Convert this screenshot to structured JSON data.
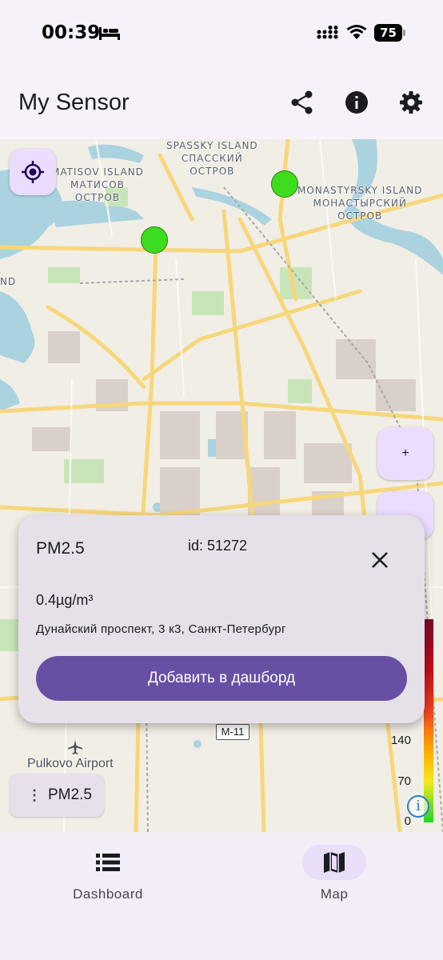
{
  "status_bar": {
    "time": "00:39",
    "battery": "75"
  },
  "app_bar": {
    "title": "My Sensor"
  },
  "map": {
    "labels": {
      "spassky": "SPASSKY ISLAND\nСПАССКИЙ\nОСТРОВ",
      "matisov": "MATISOV ISLAND\nМАТИСОВ\nОСТРОВ",
      "monastyrsky": "MONASTYRSKY ISLAND\nМОНАСТЫРСКИЙ\nОСТРОВ",
      "island_fragment": "ND",
      "pulkovo": "Pulkovo Airport",
      "m11": "M-11"
    },
    "zoom_in_label": "+",
    "sensor_color": "#3ddc1e",
    "legend": {
      "ticks": [
        "140",
        "70",
        "0"
      ],
      "info_glyph": "i"
    },
    "metric_chip": {
      "dots": "⋮",
      "label": "PM2.5"
    }
  },
  "popup": {
    "metric": "PM2.5",
    "id": "id: 51272",
    "value": "0.4µg/m³",
    "address": "Дунайский проспект, 3 к3, Санкт-Петербург",
    "add_button": "Добавить в дашборд"
  },
  "bottom_nav": {
    "items": [
      {
        "label": "Dashboard",
        "icon": "list-icon",
        "selected": false
      },
      {
        "label": "Map",
        "icon": "map-icon",
        "selected": true
      }
    ]
  },
  "colors": {
    "primary": "#6750a4",
    "primary_container": "#eaddff",
    "surface": "#f7f2fa"
  }
}
